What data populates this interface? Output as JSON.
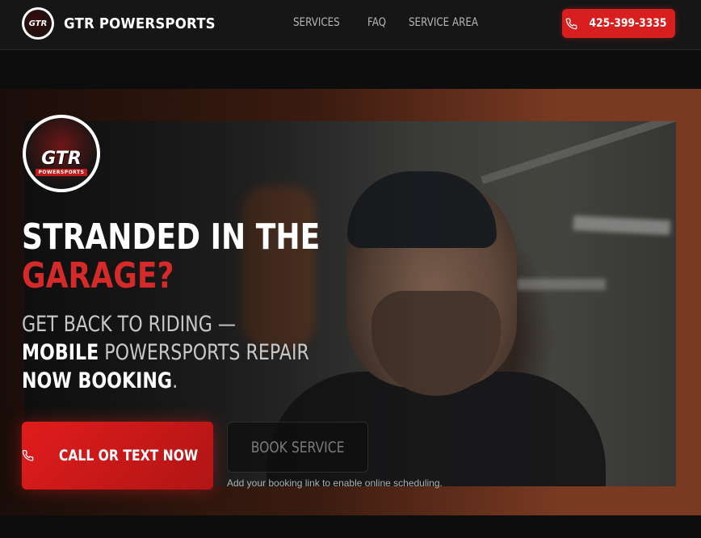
{
  "header": {
    "brand_name": "GTR POWERSPORTS",
    "logo_text": "GTR",
    "nav": [
      {
        "label": "SERVICES"
      },
      {
        "label": "FAQ"
      },
      {
        "label": "SERVICE AREA"
      }
    ],
    "phone_label": "425-399-3335"
  },
  "hero": {
    "logo_text": "GTR",
    "logo_subtext": "POWERSPORTS",
    "headline_line1": "STRANDED IN THE",
    "headline_line2": "GARAGE?",
    "sub_line1": "GET BACK TO RIDING —",
    "sub_line2_bold": "MOBILE",
    "sub_line2_rest": " POWERSPORTS REPAIR",
    "sub_line3_bold": "NOW BOOKING",
    "sub_line3_rest": ".",
    "cta_label": "CALL OR TEXT NOW",
    "book_label": "BOOK SERVICE",
    "book_hint": "Add your booking link to enable online scheduling."
  },
  "colors": {
    "accent_red": "#d81f1f",
    "headline_red": "#d42a2a",
    "header_bg": "#161616"
  },
  "icons": {
    "phone": "phone-icon"
  }
}
